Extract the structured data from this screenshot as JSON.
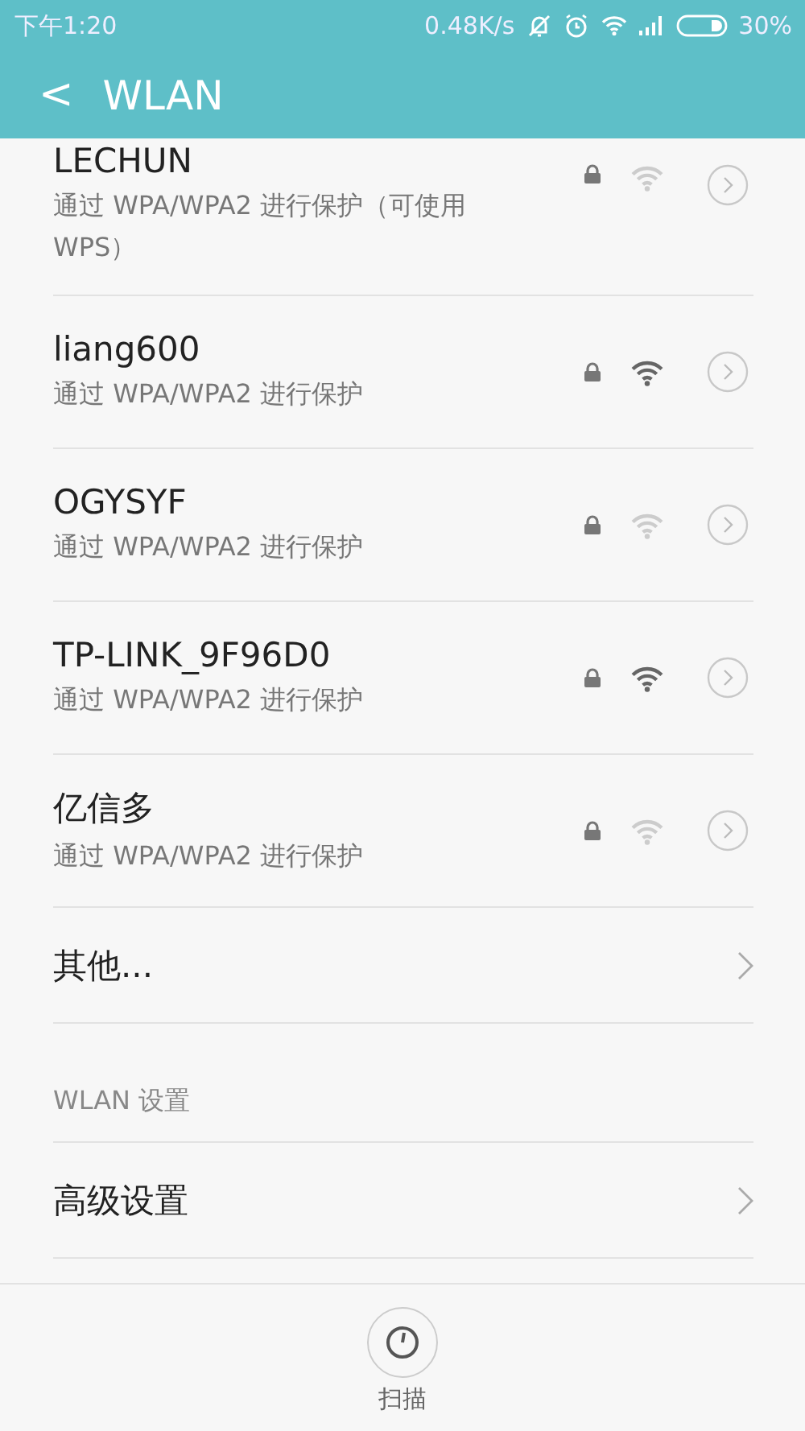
{
  "status_bar": {
    "time": "下午1:20",
    "speed": "0.48K/s",
    "battery": "30%"
  },
  "header": {
    "back": "<",
    "title": "WLAN"
  },
  "networks": [
    {
      "name": "LECHUN",
      "security": "通过 WPA/WPA2 进行保护（可使用 WPS）",
      "locked": true,
      "strong": false
    },
    {
      "name": "liang600",
      "security": "通过 WPA/WPA2 进行保护",
      "locked": true,
      "strong": true
    },
    {
      "name": "OGYSYF",
      "security": "通过 WPA/WPA2 进行保护",
      "locked": true,
      "strong": false
    },
    {
      "name": "TP-LINK_9F96D0",
      "security": "通过 WPA/WPA2 进行保护",
      "locked": true,
      "strong": true
    },
    {
      "name": "亿信多",
      "security": "通过 WPA/WPA2 进行保护",
      "locked": true,
      "strong": false
    }
  ],
  "other": "其他...",
  "section": "WLAN 设置",
  "advanced": "高级设置",
  "scan": "扫描"
}
